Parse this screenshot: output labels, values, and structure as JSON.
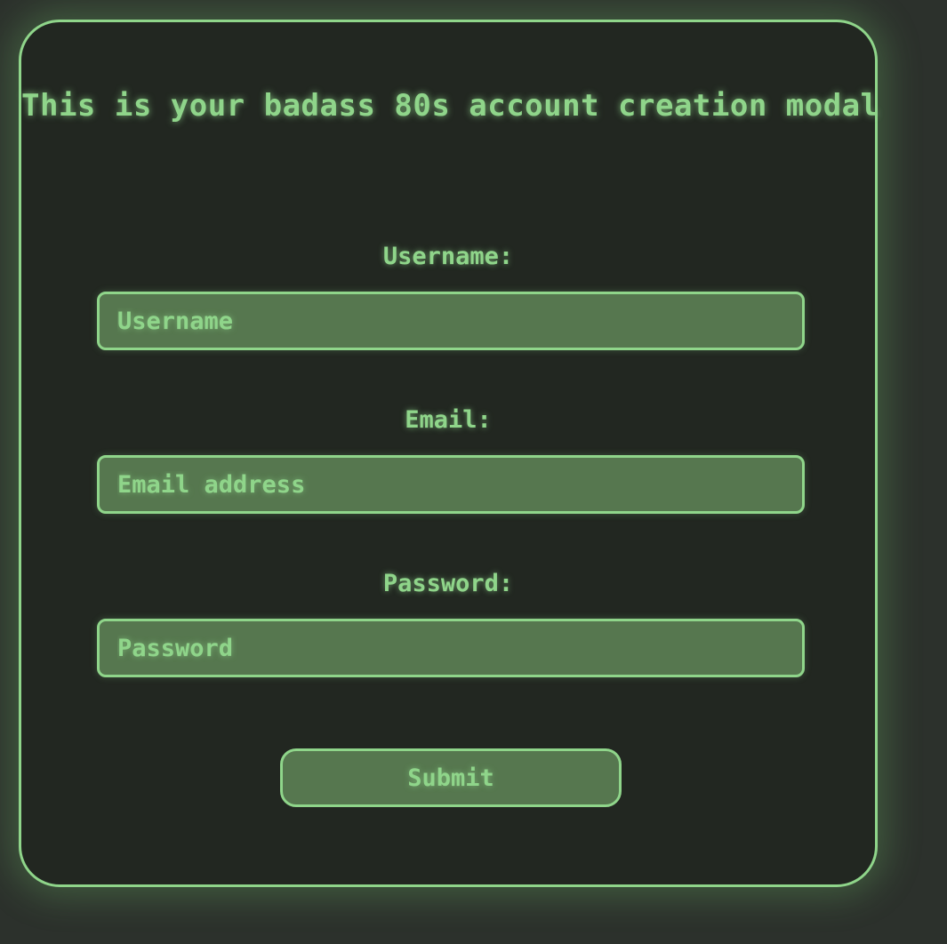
{
  "modal": {
    "title": "This is your badass 80s account creation modal",
    "fields": [
      {
        "label": "Username:",
        "placeholder": "Username",
        "value": ""
      },
      {
        "label": "Email:",
        "placeholder": "Email address",
        "value": ""
      },
      {
        "label": "Password:",
        "placeholder": "Password",
        "value": ""
      }
    ],
    "submit_label": "Submit"
  },
  "colors": {
    "accent": "#8fd58a",
    "page_background": "#2c312c",
    "modal_background": "#222721",
    "input_background": "#56774f"
  }
}
